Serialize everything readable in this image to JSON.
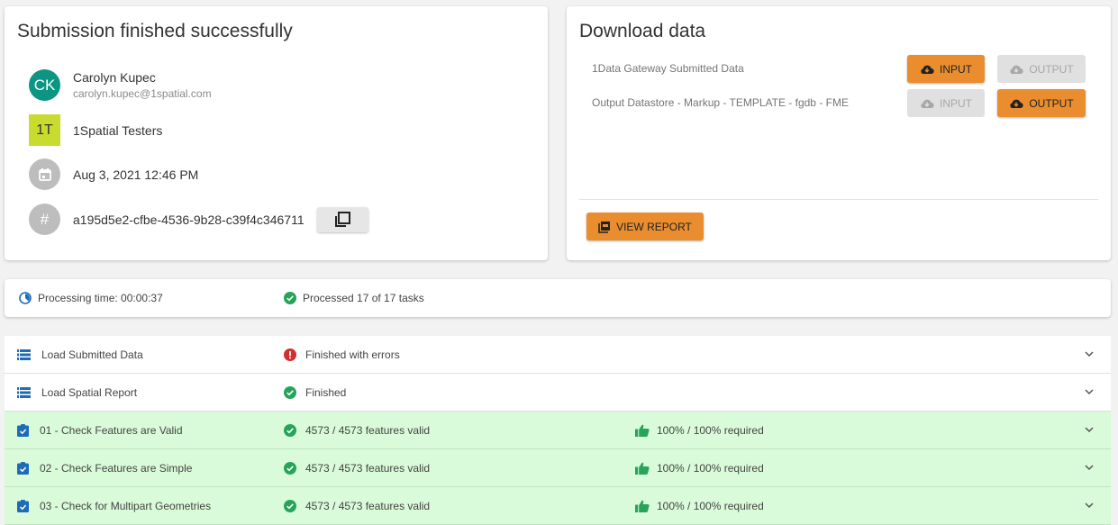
{
  "submission": {
    "title": "Submission finished successfully",
    "user_initials": "CK",
    "user_name": "Carolyn Kupec",
    "user_email": "carolyn.kupec@1spatial.com",
    "org_initials": "1T",
    "org_name": "1Spatial Testers",
    "date": "Aug 3, 2021 12:46 PM",
    "hash_symbol": "#",
    "submission_id": "a195d5e2-cfbe-4536-9b28-c39f4c346711"
  },
  "download": {
    "title": "Download data",
    "rows": [
      {
        "label": "1Data Gateway Submitted Data",
        "input_label": "INPUT",
        "output_label": "OUTPUT"
      },
      {
        "label": "Output Datastore - Markup - TEMPLATE - fgdb - FME",
        "input_label": "INPUT",
        "output_label": "OUTPUT"
      }
    ],
    "view_report_label": "VIEW REPORT"
  },
  "processing": {
    "time": "Processing time: 00:00:37",
    "tasks": "Processed 17 of 17 tasks"
  },
  "tasks": [
    {
      "name": "Load Submitted Data",
      "status": "Finished with errors",
      "required": ""
    },
    {
      "name": "Load Spatial Report",
      "status": "Finished",
      "required": ""
    },
    {
      "name": "01 - Check Features are Valid",
      "status": "4573 / 4573 features valid",
      "required": "100% / 100% required"
    },
    {
      "name": "02 - Check Features are Simple",
      "status": "4573 / 4573 features valid",
      "required": "100% / 100% required"
    },
    {
      "name": "03 - Check for Multipart Geometries",
      "status": "4573 / 4573 features valid",
      "required": "100% / 100% required"
    }
  ],
  "colors": {
    "accent_orange": "#ea8d2e",
    "success_green": "#27a35a",
    "error_red": "#d32f2f",
    "avatar_teal": "#0b9582",
    "org_yellow_green": "#c8dc30",
    "task_blue": "#1e6bb8",
    "row_green_bg": "#d9fbd9"
  },
  "icons": {
    "calendar": "calendar-icon",
    "copy": "copy-icon",
    "cloud_download": "cloud-download-icon",
    "pdf": "pdf-icon",
    "timer": "timer-icon",
    "check_circle": "check-circle-icon",
    "error_circle": "error-circle-icon",
    "list": "list-icon",
    "clipboard": "clipboard-check-icon",
    "thumbs_up": "thumbs-up-icon",
    "chevron_down": "chevron-down-icon"
  }
}
